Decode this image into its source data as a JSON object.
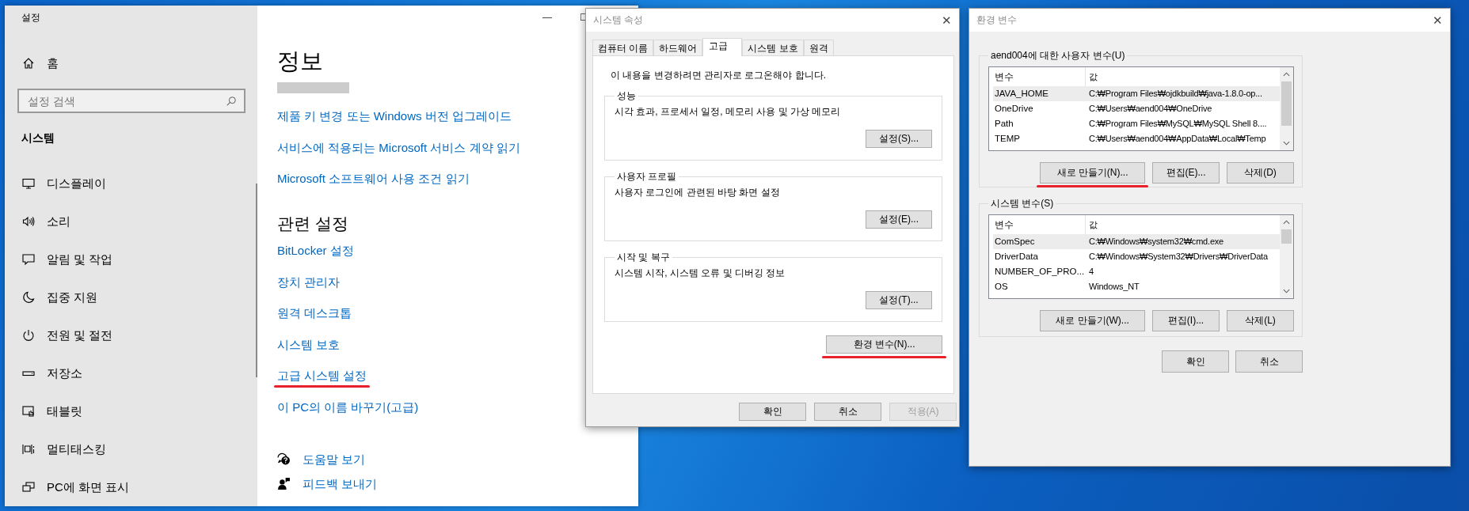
{
  "settings": {
    "title": "설정",
    "window_controls": [
      "—",
      "☐"
    ],
    "home": "홈",
    "search": {
      "placeholder": "설정 검색"
    },
    "section": "시스템",
    "nav": [
      {
        "label": "디스플레이",
        "kind": "display"
      },
      {
        "label": "소리",
        "kind": "sound"
      },
      {
        "label": "알림 및 작업",
        "kind": "notifications"
      },
      {
        "label": "집중 지원",
        "kind": "moon"
      },
      {
        "label": "전원 및 절전",
        "kind": "power"
      },
      {
        "label": "저장소",
        "kind": "storage"
      },
      {
        "label": "태블릿",
        "kind": "tablet"
      },
      {
        "label": "멀티태스킹",
        "kind": "multitasking"
      },
      {
        "label": "PC에 화면 표시",
        "kind": "project"
      }
    ],
    "heading": "정보",
    "links": [
      {
        "label": "제품 키 변경 또는 Windows 버전 업그레이드",
        "annotated": false
      },
      {
        "label": "서비스에 적용되는 Microsoft 서비스 계약 읽기",
        "annotated": false
      },
      {
        "label": "Microsoft 소프트웨어 사용 조건 읽기",
        "annotated": false
      }
    ],
    "related_heading": "관련 설정",
    "related_links": [
      {
        "label": "BitLocker 설정",
        "annotated": false
      },
      {
        "label": "장치 관리자",
        "annotated": false
      },
      {
        "label": "원격 데스크톱",
        "annotated": false
      },
      {
        "label": "시스템 보호",
        "annotated": false
      },
      {
        "label": "고급 시스템 설정",
        "annotated": true
      },
      {
        "label": "이 PC의 이름 바꾸기(고급)",
        "annotated": false
      }
    ],
    "help": [
      {
        "label": "도움말 보기",
        "kind": "help"
      },
      {
        "label": "피드백 보내기",
        "kind": "feedback"
      }
    ]
  },
  "system_properties": {
    "title": "시스템 속성",
    "close": "✕",
    "tabs": [
      {
        "label": "컴퓨터 이름",
        "selected": false
      },
      {
        "label": "하드웨어",
        "selected": false
      },
      {
        "label": "고급",
        "selected": true
      },
      {
        "label": "시스템 보호",
        "selected": false
      },
      {
        "label": "원격",
        "selected": false
      }
    ],
    "notice": "이 내용을 변경하려면 관리자로 로그온해야 합니다.",
    "groups": [
      {
        "title": "성능",
        "description": "시각 효과, 프로세서 일정, 메모리 사용 및 가상 메모리",
        "button": "설정(S)..."
      },
      {
        "title": "사용자 프로필",
        "description": "사용자 로그인에 관련된 바탕 화면 설정",
        "button": "설정(E)..."
      },
      {
        "title": "시작 및 복구",
        "description": "시스템 시작, 시스템 오류 및 디버깅 정보",
        "button": "설정(T)..."
      }
    ],
    "env_button": {
      "label": "환경 변수(N)...",
      "annotated": true
    },
    "buttons": [
      {
        "label": "확인",
        "disabled": false
      },
      {
        "label": "취소",
        "disabled": false
      },
      {
        "label": "적용(A)",
        "disabled": true
      }
    ]
  },
  "environment_variables": {
    "title": "환경 변수",
    "close": "✕",
    "lists": [
      {
        "title": "aend004에 대한 사용자 변수(U)",
        "columns": [
          "변수",
          "값"
        ],
        "rows": [
          {
            "name": "JAVA_HOME",
            "value": "C:₩Program Files₩ojdkbuild₩java-1.8.0-op...",
            "selected": true
          },
          {
            "name": "OneDrive",
            "value": "C:₩Users₩aend004₩OneDrive",
            "selected": false
          },
          {
            "name": "Path",
            "value": "C:₩Program Files₩MySQL₩MySQL Shell 8....",
            "selected": false
          },
          {
            "name": "TEMP",
            "value": "C:₩Users₩aend004₩AppData₩Local₩Temp",
            "selected": false
          }
        ],
        "buttons": [
          {
            "label": "새로 만들기(N)...",
            "annotated": true
          },
          {
            "label": "편집(E)...",
            "annotated": false
          },
          {
            "label": "삭제(D)",
            "annotated": false
          }
        ]
      },
      {
        "title": "시스템 변수(S)",
        "columns": [
          "변수",
          "값"
        ],
        "rows": [
          {
            "name": "ComSpec",
            "value": "C:₩Windows₩system32₩cmd.exe",
            "selected": true
          },
          {
            "name": "DriverData",
            "value": "C:₩Windows₩System32₩Drivers₩DriverData",
            "selected": false
          },
          {
            "name": "NUMBER_OF_PRO...",
            "value": "4",
            "selected": false
          },
          {
            "name": "OS",
            "value": "Windows_NT",
            "selected": false
          }
        ],
        "buttons": [
          {
            "label": "새로 만들기(W)...",
            "annotated": false
          },
          {
            "label": "편집(I)...",
            "annotated": false
          },
          {
            "label": "삭제(L)",
            "annotated": false
          }
        ]
      }
    ],
    "buttons": [
      "확인",
      "취소"
    ]
  }
}
